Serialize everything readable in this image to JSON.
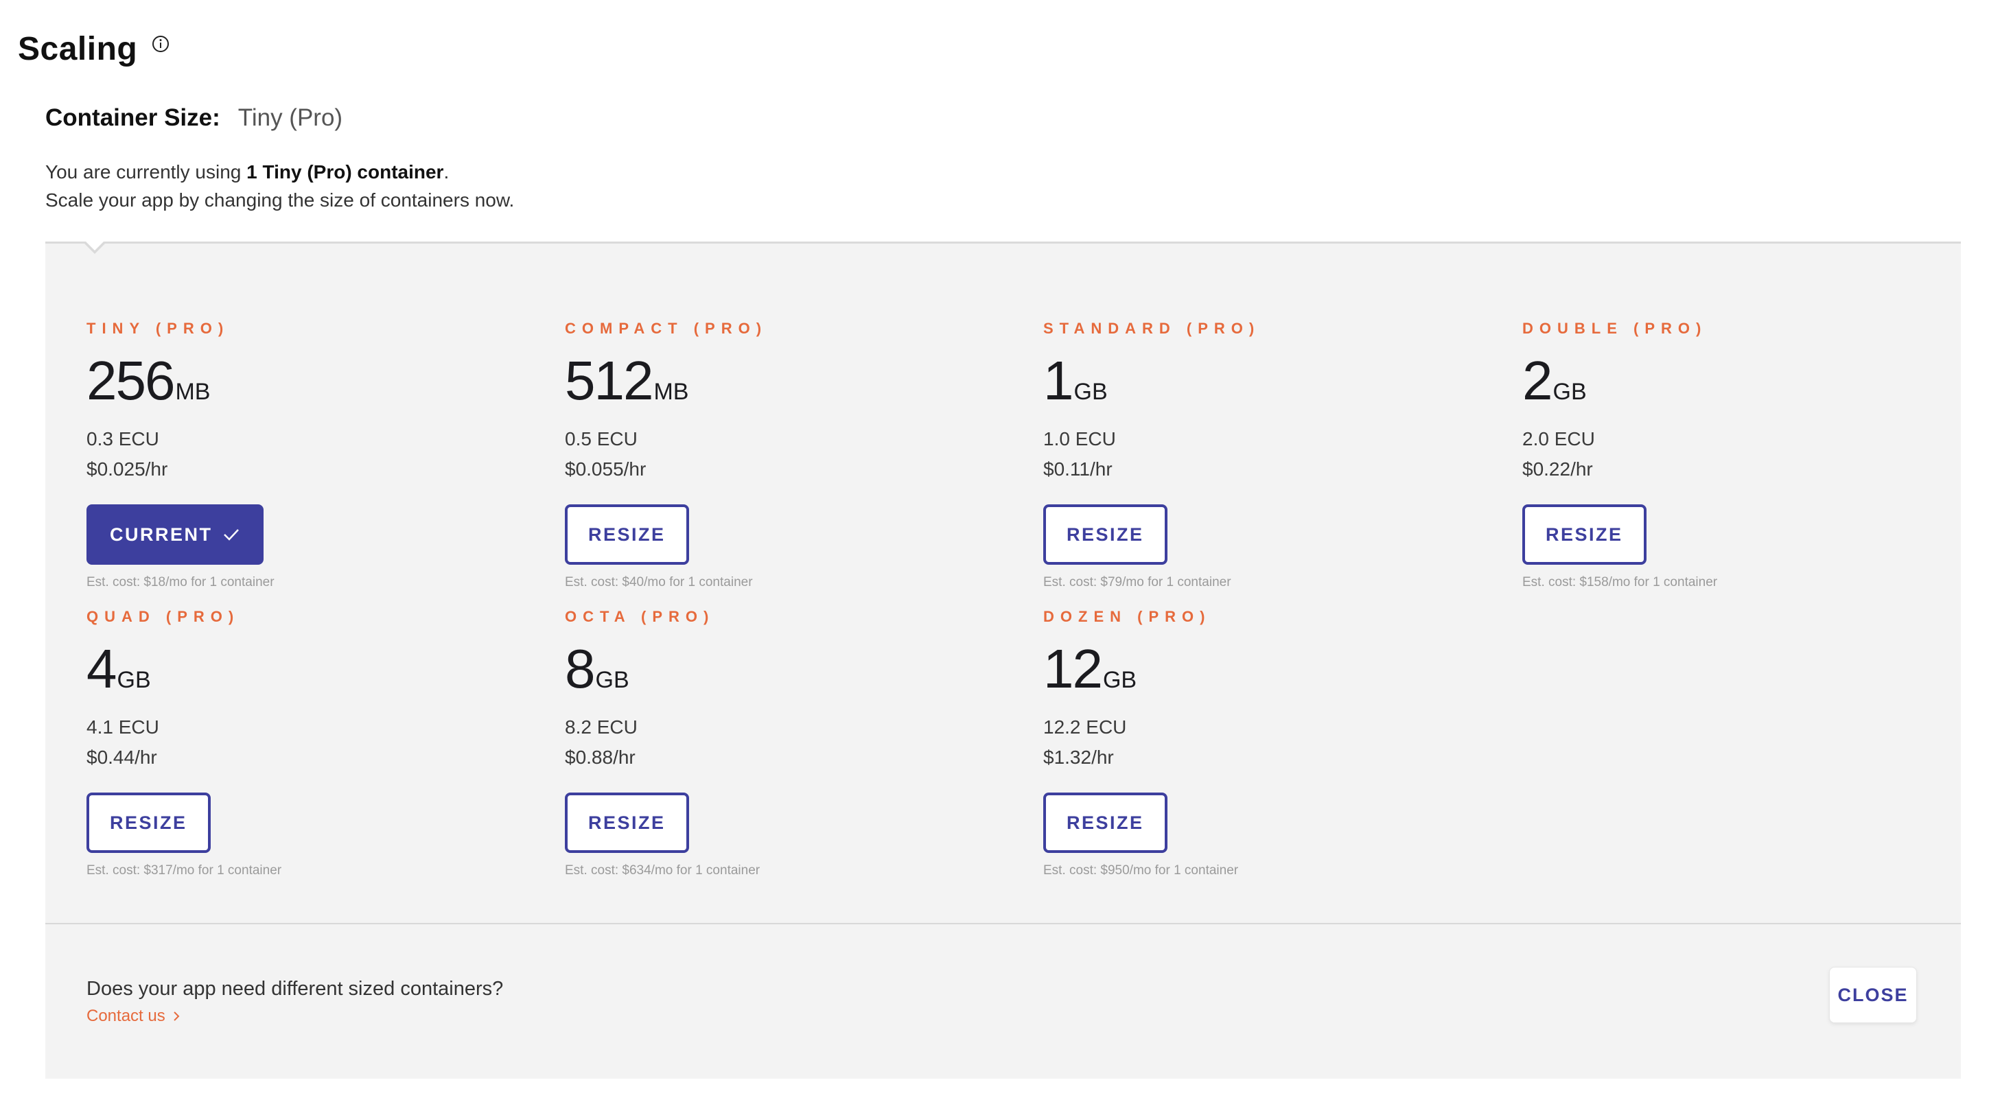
{
  "header": {
    "title": "Scaling",
    "info_icon": "info-circle-icon"
  },
  "container_size": {
    "label": "Container Size:",
    "value": "Tiny (Pro)"
  },
  "intro": {
    "prefix": "You are currently using ",
    "highlight": "1 Tiny (Pro) container",
    "suffix": ".",
    "line2": "Scale your app by changing the size of containers now."
  },
  "cards": [
    {
      "name": "TINY (PRO)",
      "size": "256",
      "unit": "MB",
      "ecu": "0.3 ECU",
      "price": "$0.025/hr",
      "button": "CURRENT",
      "est": "Est. cost: $18/mo for 1 container"
    },
    {
      "name": "COMPACT (PRO)",
      "size": "512",
      "unit": "MB",
      "ecu": "0.5 ECU",
      "price": "$0.055/hr",
      "button": "RESIZE",
      "est": "Est. cost: $40/mo for 1 container"
    },
    {
      "name": "STANDARD (PRO)",
      "size": "1",
      "unit": "GB",
      "ecu": "1.0 ECU",
      "price": "$0.11/hr",
      "button": "RESIZE",
      "est": "Est. cost: $79/mo for 1 container"
    },
    {
      "name": "DOUBLE (PRO)",
      "size": "2",
      "unit": "GB",
      "ecu": "2.0 ECU",
      "price": "$0.22/hr",
      "button": "RESIZE",
      "est": "Est. cost: $158/mo for 1 container"
    },
    {
      "name": "QUAD (PRO)",
      "size": "4",
      "unit": "GB",
      "ecu": "4.1 ECU",
      "price": "$0.44/hr",
      "button": "RESIZE",
      "est": "Est. cost: $317/mo for 1 container"
    },
    {
      "name": "OCTA (PRO)",
      "size": "8",
      "unit": "GB",
      "ecu": "8.2 ECU",
      "price": "$0.88/hr",
      "button": "RESIZE",
      "est": "Est. cost: $634/mo for 1 container"
    },
    {
      "name": "DOZEN (PRO)",
      "size": "12",
      "unit": "GB",
      "ecu": "12.2 ECU",
      "price": "$1.32/hr",
      "button": "RESIZE",
      "est": "Est. cost: $950/mo for 1 container"
    }
  ],
  "footer": {
    "question": "Does your app need different sized containers?",
    "link": "Contact us",
    "close": "CLOSE"
  },
  "colors": {
    "accent": "#3d3f9e",
    "orange": "#e66a3c",
    "panel": "#f3f3f3"
  }
}
